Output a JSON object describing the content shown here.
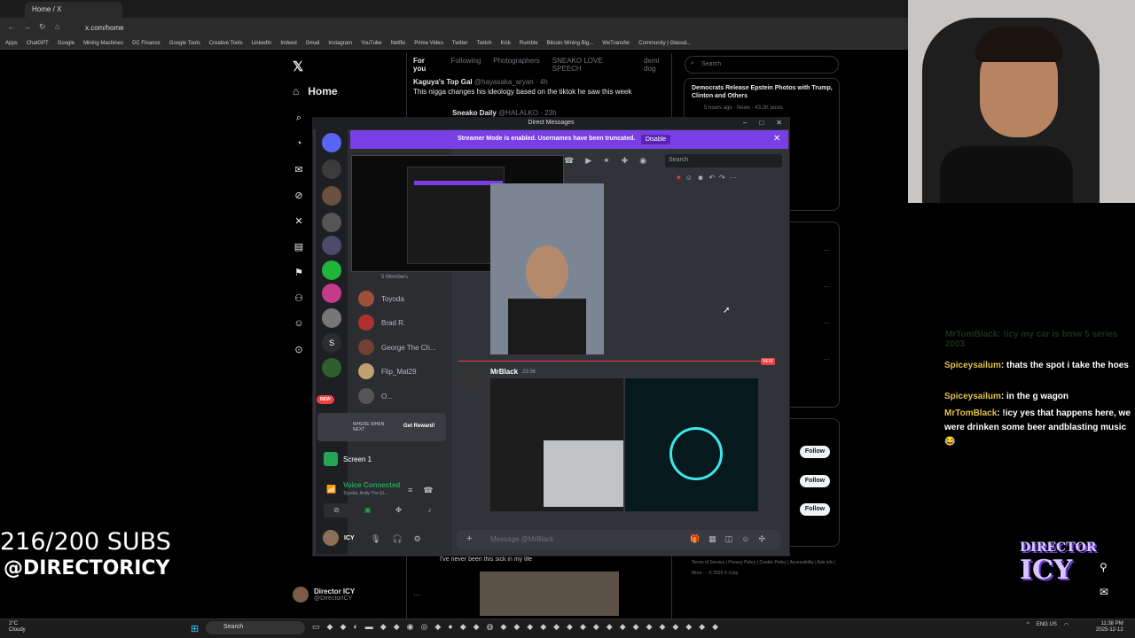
{
  "browser": {
    "tab_title": "Home / X",
    "url": "x.com/home",
    "bookmarks": [
      "Apps",
      "ChatGPT",
      "Google",
      "Mining Machines",
      "DC Finance",
      "Google Tools",
      "Creative Tools",
      "LinkedIn",
      "Indeed",
      "Gmail",
      "Instagram",
      "YouTube",
      "Netflix",
      "Prime Video",
      "Twitter",
      "Twitch",
      "Kick",
      "Rumble",
      "Bitcoin Mining Big...",
      "WeTransfer",
      "Community | Glassd..."
    ]
  },
  "x": {
    "home_label": "Home",
    "feed_tabs": [
      "For you",
      "Following",
      "Photographers",
      "SNEAKO LOVE SPEECH",
      "demi dog"
    ],
    "tweet1": {
      "name": "Kaguya's Top Gal",
      "handle": "@hayasaka_aryan · 4h",
      "text": "This nigga changes his ideology based on the tiktok he saw this week"
    },
    "tweet2_name": "Sneako Daily",
    "tweet2_handle": "@HALALKO · 23h",
    "tweet_bottom_text": "I've never been this sick in my life",
    "search_placeholder": "Search",
    "news_title": "Democrats Release Epstein Photos with Trump, Clinton and Others",
    "news_meta": "5 hours ago · News · 43.2K posts",
    "follow_label": "Follow",
    "footer_links": "Terms of Service | Privacy Policy | Cookie Policy | Accessibility | Ads info | More ··· © 2025 X Corp.",
    "profile_name": "Director ICY",
    "profile_handle": "@DirectorICY"
  },
  "discord": {
    "window_title": "Direct Messages",
    "streamer_banner": "Streamer Mode is enabled. Usernames have been truncated.",
    "disable_label": "Disable",
    "search_placeholder": "Search",
    "members_label": "5 Members",
    "members": [
      "Toyoda",
      "Brad R.",
      "George The Ch...",
      "Flip_Mat29",
      "O..."
    ],
    "new_label": "NEW",
    "boost_cta": "Get Reward!",
    "boost_text": "WHERE WHEN NEXT",
    "screen_share": "Screen 1",
    "voice_status": "Voice Connected",
    "voice_names": "Toyoda, Andy The El...",
    "user_name": "ICY",
    "message_author": "MrBlack",
    "message_time": "23:36",
    "new_badge": "NEW",
    "input_placeholder": "Message @MrBlack"
  },
  "overlay": {
    "subs": "216/200 SUBS",
    "handle": "@DIRECTORICY",
    "chat": [
      {
        "user": "MrTomBlack",
        "text": ": !icy my car is bmw 5 series 2003",
        "faded": true
      },
      {
        "user": "Spiceysailum",
        "text": ": thats the spot i take the hoes"
      },
      {
        "user": "Spiceysailum",
        "text": ": in the g wagon"
      },
      {
        "user": "MrTomBlack",
        "text": ": !icy yes that happens here, we were drinken some beer andblasting music😂"
      }
    ],
    "logo_top": "DIRECTOR",
    "logo_bottom": "ICY"
  },
  "taskbar": {
    "weather_temp": "2°C",
    "weather_desc": "Cloudy",
    "search": "Search",
    "lang": "ENG US",
    "time": "11:38 PM",
    "date": "2025-12-12"
  }
}
